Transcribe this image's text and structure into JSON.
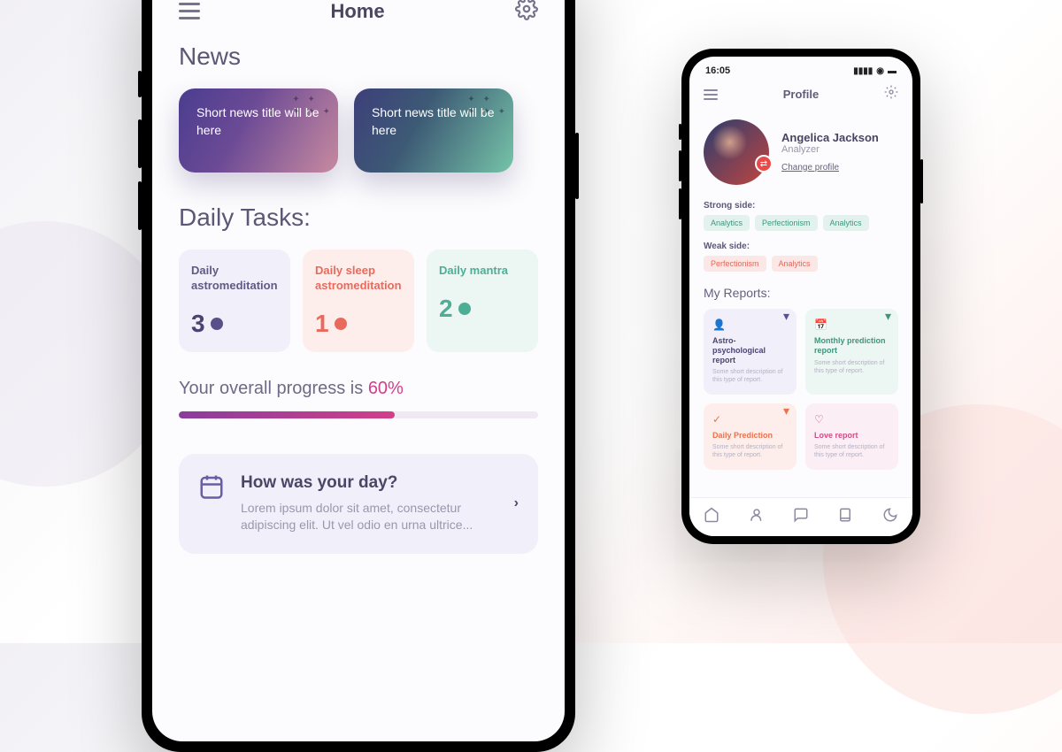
{
  "home": {
    "title": "Home",
    "news_heading": "News",
    "news": [
      {
        "title": "Short news title will be here"
      },
      {
        "title": "Short news title will be here"
      }
    ],
    "tasks_heading": "Daily Tasks:",
    "tasks": [
      {
        "label": "Daily astromeditation",
        "count": "3"
      },
      {
        "label": "Daily sleep astromeditation",
        "count": "1"
      },
      {
        "label": "Daily mantra",
        "count": "2"
      }
    ],
    "progress": {
      "prefix": "Your overall progress is ",
      "value": "60%",
      "width": "60%"
    },
    "day_card": {
      "title": "How was your day?",
      "desc": "Lorem ipsum dolor sit amet, consectetur adipiscing elit. Ut vel odio en urna ultrice..."
    }
  },
  "profile": {
    "status_time": "16:05",
    "title": "Profile",
    "name": "Angelica Jackson",
    "role": "Analyzer",
    "change_link": "Change profile",
    "strong_label": "Strong side:",
    "strong_tags": [
      "Analytics",
      "Perfectionism",
      "Analytics"
    ],
    "weak_label": "Weak side:",
    "weak_tags": [
      "Perfectionism",
      "Analytics"
    ],
    "reports_heading": "My Reports:",
    "reports": [
      {
        "title": "Astro- psychological report",
        "desc": "Some short description of this type of report."
      },
      {
        "title": "Monthly prediction report",
        "desc": "Some short description of this type of report."
      },
      {
        "title": "Daily Prediction",
        "desc": "Some short description of this type of report."
      },
      {
        "title": "Love report",
        "desc": "Some short description of this type of report."
      }
    ]
  }
}
